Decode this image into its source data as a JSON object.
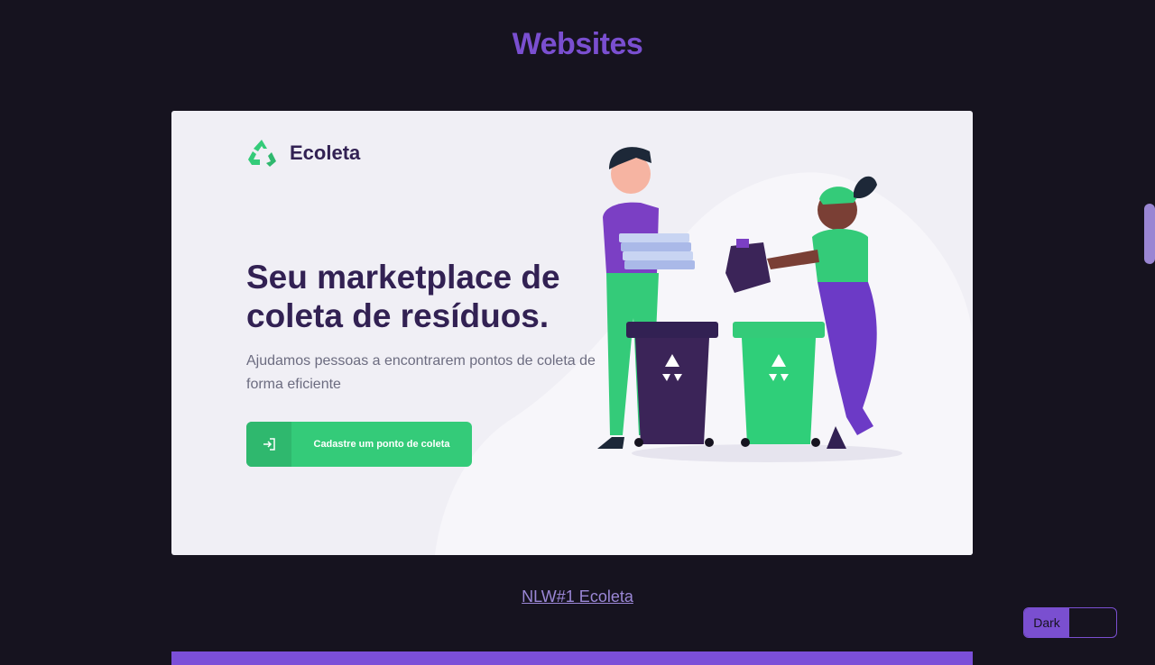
{
  "section": {
    "title": "Websites"
  },
  "project": {
    "logo_text": "Ecoleta",
    "headline": "Seu marketplace de coleta de resíduos.",
    "subline": "Ajudamos pessoas a encontrarem pontos de coleta de forma eficiente",
    "cta_label": "Cadastre um ponto de coleta",
    "link_text": "NLW#1 Ecoleta"
  },
  "theme_toggle": {
    "label": "Dark"
  },
  "icons": {
    "logo": "recycle-icon",
    "cta": "login-arrow-icon",
    "bin": "recycle-icon"
  },
  "colors": {
    "background": "#16131f",
    "accent": "#7a4fd0",
    "brand_green": "#34cb79",
    "brand_dark": "#322153",
    "card_bg": "#f0eff5"
  }
}
